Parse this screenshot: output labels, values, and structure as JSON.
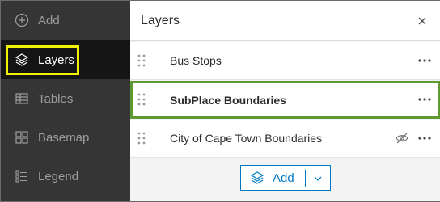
{
  "sidebar": {
    "items": [
      {
        "label": "Add",
        "icon": "plus-circle-icon",
        "active": false
      },
      {
        "label": "Layers",
        "icon": "layers-icon",
        "active": true
      },
      {
        "label": "Tables",
        "icon": "table-icon",
        "active": false
      },
      {
        "label": "Basemap",
        "icon": "basemap-icon",
        "active": false
      },
      {
        "label": "Legend",
        "icon": "legend-icon",
        "active": false
      }
    ]
  },
  "panel": {
    "title": "Layers",
    "layers": [
      {
        "label": "Bus Stops",
        "selected": false,
        "hidden": false
      },
      {
        "label": "SubPlace Boundaries",
        "selected": true,
        "hidden": false
      },
      {
        "label": "City of Cape Town Boundaries",
        "selected": false,
        "hidden": true
      }
    ],
    "add_button": {
      "label": "Add"
    }
  },
  "colors": {
    "sidebar_bg": "#353535",
    "sidebar_active_bg": "#151515",
    "active_highlight": "#f2f200",
    "selected_border": "#5d9b32",
    "accent": "#007ac2"
  }
}
